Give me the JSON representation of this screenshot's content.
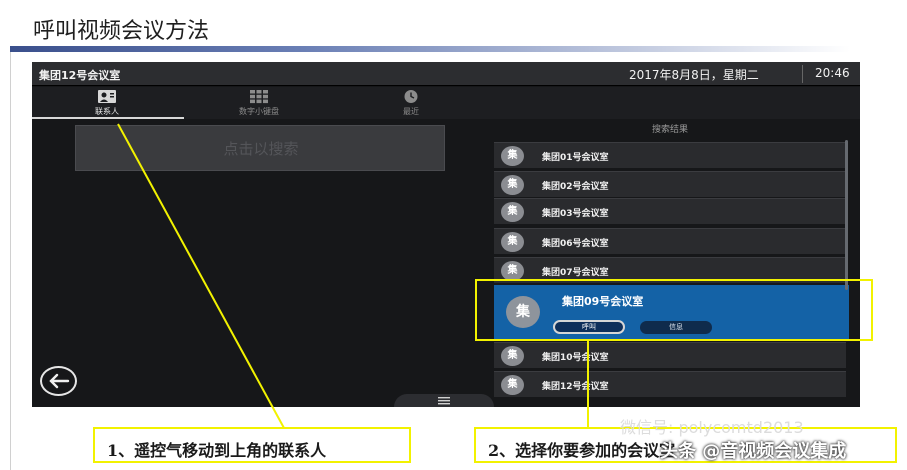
{
  "slide": {
    "title": "呼叫视频会议方法"
  },
  "device": {
    "room_name": "集团12号会议室",
    "date": "2017年8月8日，星期二",
    "time": "20:46",
    "tabs": [
      {
        "label": "联系人",
        "icon": "contact-card-icon",
        "active": true
      },
      {
        "label": "数字小键盘",
        "icon": "keypad-icon",
        "active": false
      },
      {
        "label": "最近",
        "icon": "clock-icon",
        "active": false
      }
    ],
    "search_placeholder": "点击以搜索",
    "results_title": "搜索结果",
    "avatar_char": "集",
    "results": [
      {
        "label": "集团01号会议室"
      },
      {
        "label": "集团02号会议室"
      },
      {
        "label": "集团03号会议室"
      },
      {
        "label": "集团06号会议室"
      },
      {
        "label": "集团07号会议室"
      }
    ],
    "selected": {
      "label": "集团09号会议室",
      "call_label": "呼叫",
      "info_label": "信息"
    },
    "results_after": [
      {
        "label": "集团10号会议室"
      },
      {
        "label": "集团12号会议室"
      }
    ],
    "back_icon": "back-arrow-icon",
    "menu_icon": "menu-lines-icon"
  },
  "annotations": {
    "caption1": "1、遥控气移动到上角的联系人",
    "caption2": "2、选择你要参加的会议室",
    "highlight_color": "#f2f200"
  },
  "watermark": {
    "line1": "微信号: polycomtd2013",
    "line2": "头条 @音视频会议集成"
  }
}
